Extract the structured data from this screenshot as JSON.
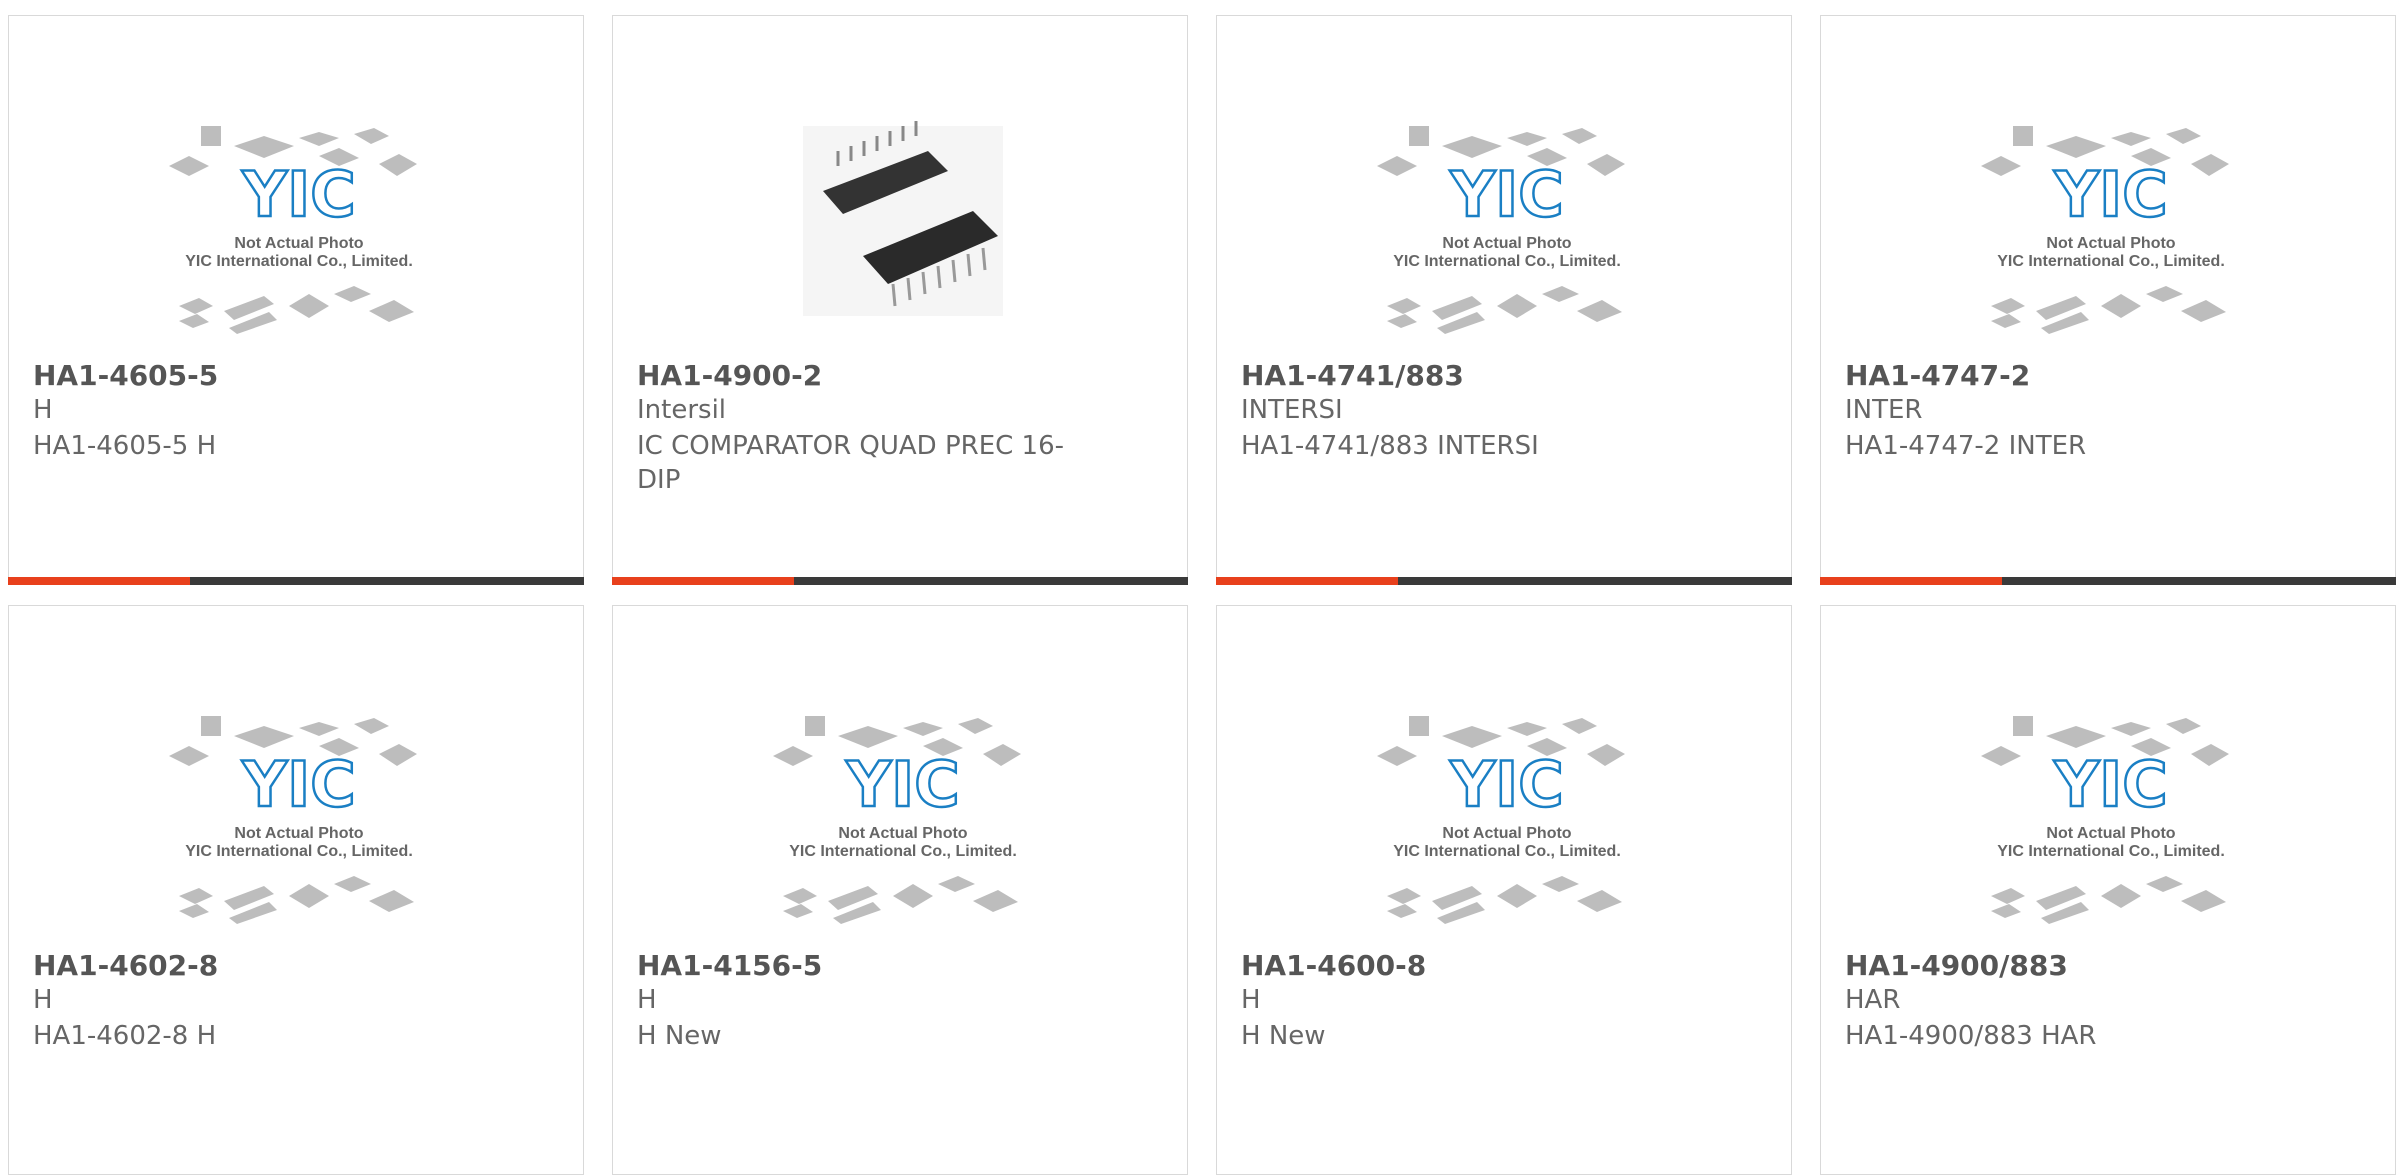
{
  "cards": [
    {
      "part": "HA1-4605-5",
      "mfr": "H",
      "desc": "HA1-4605-5 H",
      "photo": "placeholder"
    },
    {
      "part": "HA1-4900-2",
      "mfr": "Intersil",
      "desc": "IC COMPARATOR QUAD PREC 16-DIP",
      "photo": "dip-chip"
    },
    {
      "part": "HA1-4741/883",
      "mfr": "INTERSI",
      "desc": "HA1-4741/883 INTERSI",
      "photo": "placeholder"
    },
    {
      "part": "HA1-4747-2",
      "mfr": "INTER",
      "desc": "HA1-4747-2 INTER",
      "photo": "placeholder"
    },
    {
      "part": "HA1-4602-8",
      "mfr": "H",
      "desc": "HA1-4602-8 H",
      "photo": "placeholder"
    },
    {
      "part": "HA1-4156-5",
      "mfr": "H",
      "desc": "H New",
      "photo": "placeholder"
    },
    {
      "part": "HA1-4600-8",
      "mfr": "H",
      "desc": "H New",
      "photo": "placeholder"
    },
    {
      "part": "HA1-4900/883",
      "mfr": "HAR",
      "desc": "HA1-4900/883 HAR",
      "photo": "placeholder"
    }
  ],
  "placeholder": {
    "line1": "Not Actual Photo",
    "line2": "YIC International Co., Limited.",
    "logo": "YIC"
  },
  "colors": {
    "accent": "#e8401c",
    "bar": "#3a3a3a",
    "logo": "#1a7fc4"
  }
}
